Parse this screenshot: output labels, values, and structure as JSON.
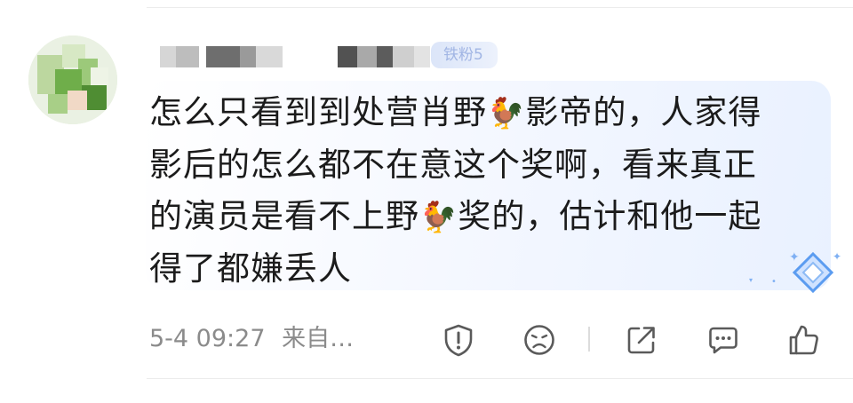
{
  "comment": {
    "badge": "铁粉5",
    "text_parts": [
      {
        "type": "text",
        "value": "怎么只看到到处营肖野"
      },
      {
        "type": "emoji",
        "name": "chicken-emoji",
        "value": "🐓"
      },
      {
        "type": "text",
        "value": "影帝的，人家得\n影后的怎么都不在意这个奖啊，看来真正\n的演员是看不上野"
      },
      {
        "type": "emoji",
        "name": "chicken-emoji",
        "value": "🐓"
      },
      {
        "type": "text",
        "value": "奖的，估计和他一起\n得了都嫌丢人"
      }
    ],
    "date": "5-4 09:27",
    "source": "来自…"
  },
  "actions": [
    {
      "name": "report-icon",
      "label": "report"
    },
    {
      "name": "dislike-icon",
      "label": "dislike"
    },
    {
      "name": "share-icon",
      "label": "share"
    },
    {
      "name": "comment-icon",
      "label": "comment"
    },
    {
      "name": "like-icon",
      "label": "like"
    }
  ],
  "colors": {
    "text": "#1b1b1b",
    "meta": "#8b8b8b",
    "icon": "#5a5a5a",
    "bubble_tint": "#e9f1ff",
    "accent": "#7fb0f3"
  }
}
